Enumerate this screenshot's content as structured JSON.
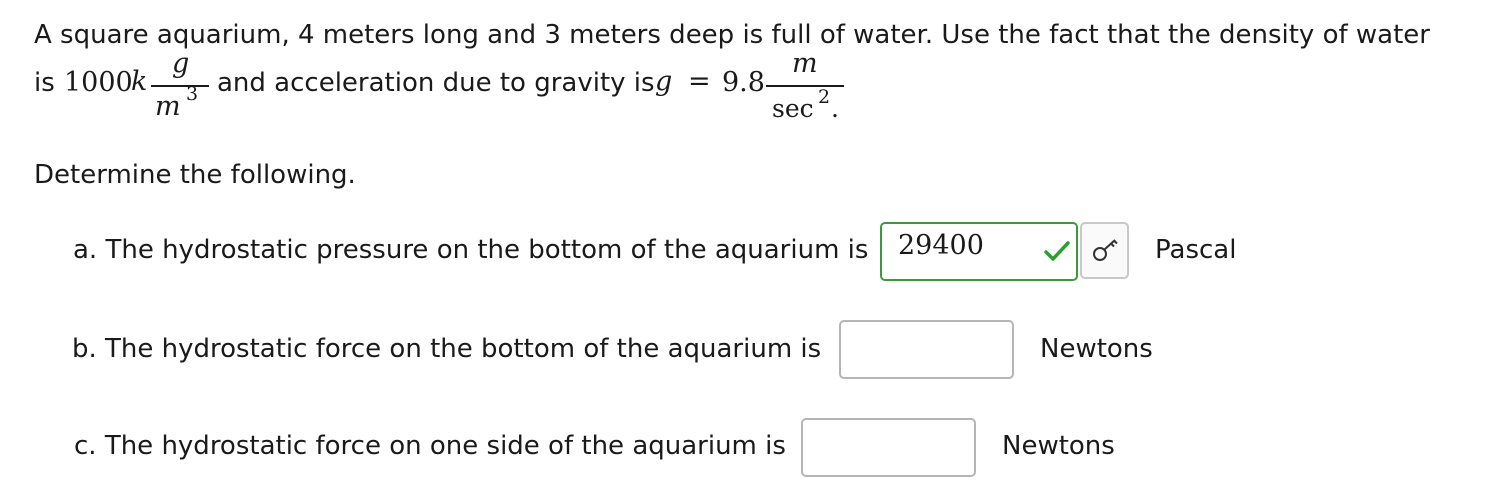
{
  "problem": {
    "line1": "A square aquarium, 4 meters long and 3 meters deep is full of water. Use the fact that the density of water",
    "is_label": "is",
    "density_value": "1000",
    "density_unit_k": "k",
    "density_num": "g",
    "density_den": "m",
    "density_den_exp": "3",
    "mid_text": "and acceleration due to gravity is",
    "g_var": "g",
    "equals": "=",
    "g_value": "9.8",
    "g_num": "m",
    "g_den": "sec",
    "g_den_exp": "2",
    "g_period": "."
  },
  "instruction": "Determine the following.",
  "questions": [
    {
      "label": "a. The hydrostatic pressure on the bottom of the aquarium is",
      "value": "29400",
      "unit": "Pascal",
      "status": "correct"
    },
    {
      "label": "b. The hydrostatic force on the bottom of the aquarium is",
      "value": "",
      "unit": "Newtons"
    },
    {
      "label": "c. The hydrostatic force on one side of the aquarium is",
      "value": "",
      "unit": "Newtons"
    }
  ],
  "icons": {
    "check": "check-icon",
    "key": "key-icon"
  },
  "colors": {
    "correct_border": "#3c9a3c",
    "check_mark": "#2e9e2e",
    "text": "#1a1a1a"
  }
}
